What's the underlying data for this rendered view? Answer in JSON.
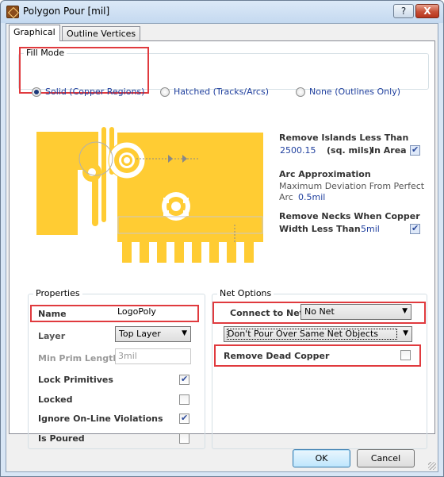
{
  "window": {
    "title": "Polygon Pour [mil]",
    "help_label": "?",
    "close_label": "X"
  },
  "tabs": [
    {
      "label": "Graphical"
    },
    {
      "label": "Outline Vertices"
    }
  ],
  "fill_mode": {
    "title": "Fill Mode",
    "options": [
      {
        "label": "Solid (Copper Regions)",
        "selected": true
      },
      {
        "label": "Hatched (Tracks/Arcs)",
        "selected": false
      },
      {
        "label": "None (Outlines Only)",
        "selected": false
      }
    ]
  },
  "preview": {
    "copper_color": "#ffcc33",
    "remove_islands": {
      "title": "Remove Islands Less Than",
      "value": "2500.15",
      "unit": "(sq. mils)",
      "in_area_label": "In Area",
      "checked": true
    },
    "arc_approx": {
      "title": "Arc Approximation",
      "desc": "Maximum Deviation From Perfect",
      "arc_label": "Arc",
      "value": "0.5mil"
    },
    "remove_necks": {
      "title": "Remove Necks When Copper",
      "width_label": "Width Less Than",
      "value": "5mil",
      "checked": true
    }
  },
  "properties": {
    "title": "Properties",
    "name_label": "Name",
    "name_value": "LogoPoly",
    "layer_label": "Layer",
    "layer_value": "Top Layer",
    "min_prim_label": "Min Prim Length",
    "min_prim_value": "3mil",
    "lock_primitives": {
      "label": "Lock Primitives",
      "checked": true
    },
    "locked": {
      "label": "Locked",
      "checked": false
    },
    "ignore_online": {
      "label": "Ignore On-Line Violations",
      "checked": true
    },
    "is_poured": {
      "label": "Is Poured",
      "checked": false
    }
  },
  "net_options": {
    "title": "Net Options",
    "connect_label": "Connect to Net",
    "connect_value": "No Net",
    "pour_mode": "Don't Pour Over Same Net Objects",
    "remove_dead": {
      "label": "Remove Dead Copper",
      "checked": false
    }
  },
  "footer": {
    "ok_label": "OK",
    "cancel_label": "Cancel"
  },
  "colors": {
    "highlight": "#e03a3e",
    "accent_text": "#1f3f9e"
  }
}
